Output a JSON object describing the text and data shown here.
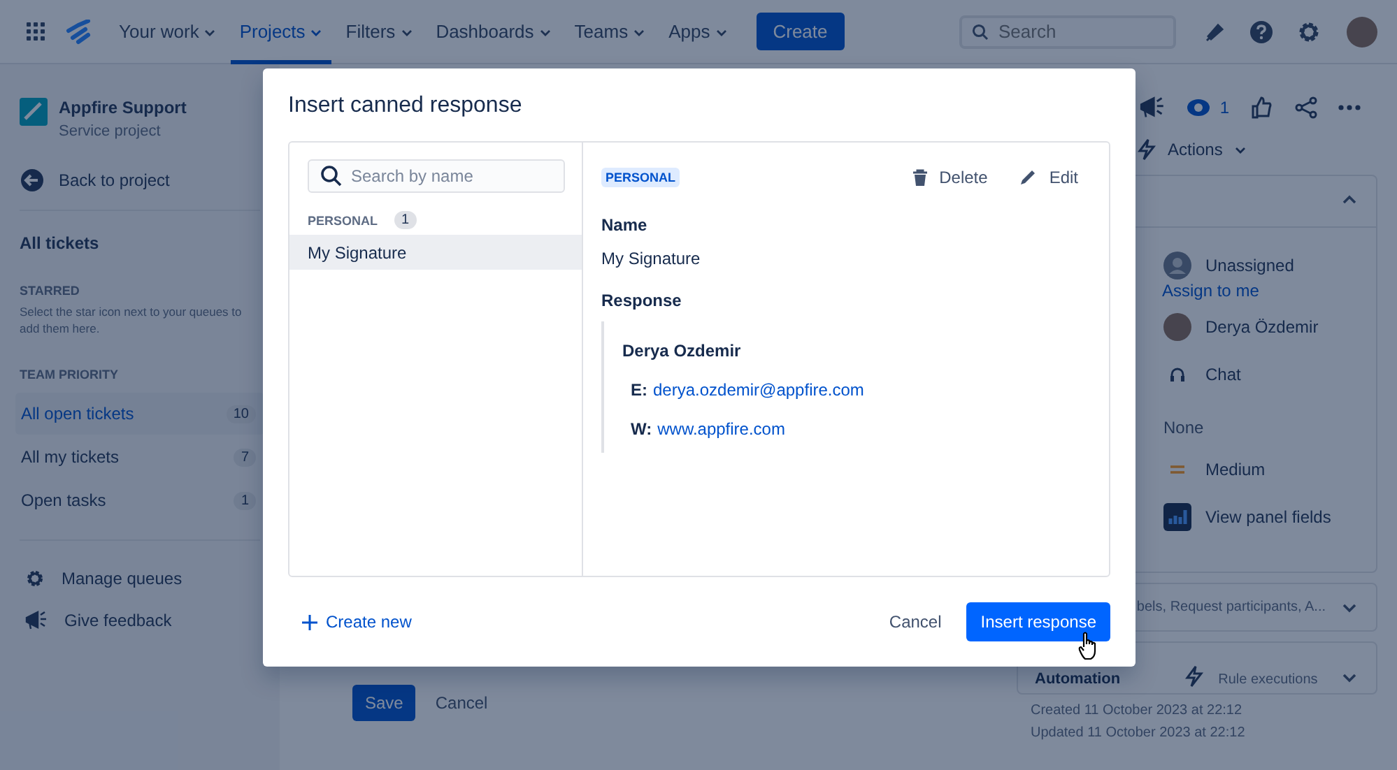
{
  "nav": {
    "items": [
      {
        "label": "Your work",
        "selected": false
      },
      {
        "label": "Projects",
        "selected": true
      },
      {
        "label": "Filters",
        "selected": false
      },
      {
        "label": "Dashboards",
        "selected": false
      },
      {
        "label": "Teams",
        "selected": false
      },
      {
        "label": "Apps",
        "selected": false
      }
    ],
    "create": "Create",
    "search": {
      "placeholder": "Search"
    }
  },
  "sidebar": {
    "project": {
      "name": "Appfire Support",
      "type": "Service project"
    },
    "back": "Back to project",
    "heading": "All tickets",
    "starred": {
      "title": "STARRED",
      "hint": "Select the star icon next to your queues to add them here."
    },
    "team_priority": {
      "title": "TEAM PRIORITY",
      "queues": [
        {
          "label": "All open tickets",
          "count": "10",
          "selected": true
        },
        {
          "label": "All my tickets",
          "count": "7",
          "selected": false
        },
        {
          "label": "Open tasks",
          "count": "1",
          "selected": false
        }
      ]
    },
    "footer": [
      {
        "label": "Manage queues",
        "kind": "gear"
      },
      {
        "label": "Give feedback",
        "kind": "megaphone"
      }
    ]
  },
  "editor": {
    "save": "Save",
    "cancel": "Cancel"
  },
  "details": {
    "watchers": "1",
    "actions": "Actions",
    "expanded": true,
    "assignee": "Unassigned",
    "assign_link": "Assign to me",
    "reporter": "Derya Özdemir",
    "channel": "Chat",
    "none": "None",
    "priority": "Medium",
    "panel_fields": "View panel fields",
    "more_fields": "bels, Request participants, A...",
    "automation": {
      "title": "Automation",
      "rule": "Rule executions"
    },
    "created": "Created 11 October 2023 at 22:12",
    "updated": "Updated 11 October 2023 at 22:12"
  },
  "modal": {
    "title": "Insert canned response",
    "search": {
      "placeholder": "Search by name"
    },
    "group": {
      "label": "PERSONAL",
      "count": "1",
      "items": [
        {
          "label": "My Signature",
          "selected": true
        }
      ]
    },
    "detail": {
      "tag": "PERSONAL",
      "delete": "Delete",
      "edit": "Edit",
      "name_label": "Name",
      "name": "My Signature",
      "response_label": "Response",
      "signature": {
        "name": "Derya Ozdemir",
        "lines": [
          {
            "label": "E:",
            "link": "derya.ozdemir@appfire.com"
          },
          {
            "label": "W:",
            "link": "www.appfire.com"
          }
        ]
      }
    },
    "create_new": "Create new",
    "cancel": "Cancel",
    "insert": "Insert response"
  }
}
